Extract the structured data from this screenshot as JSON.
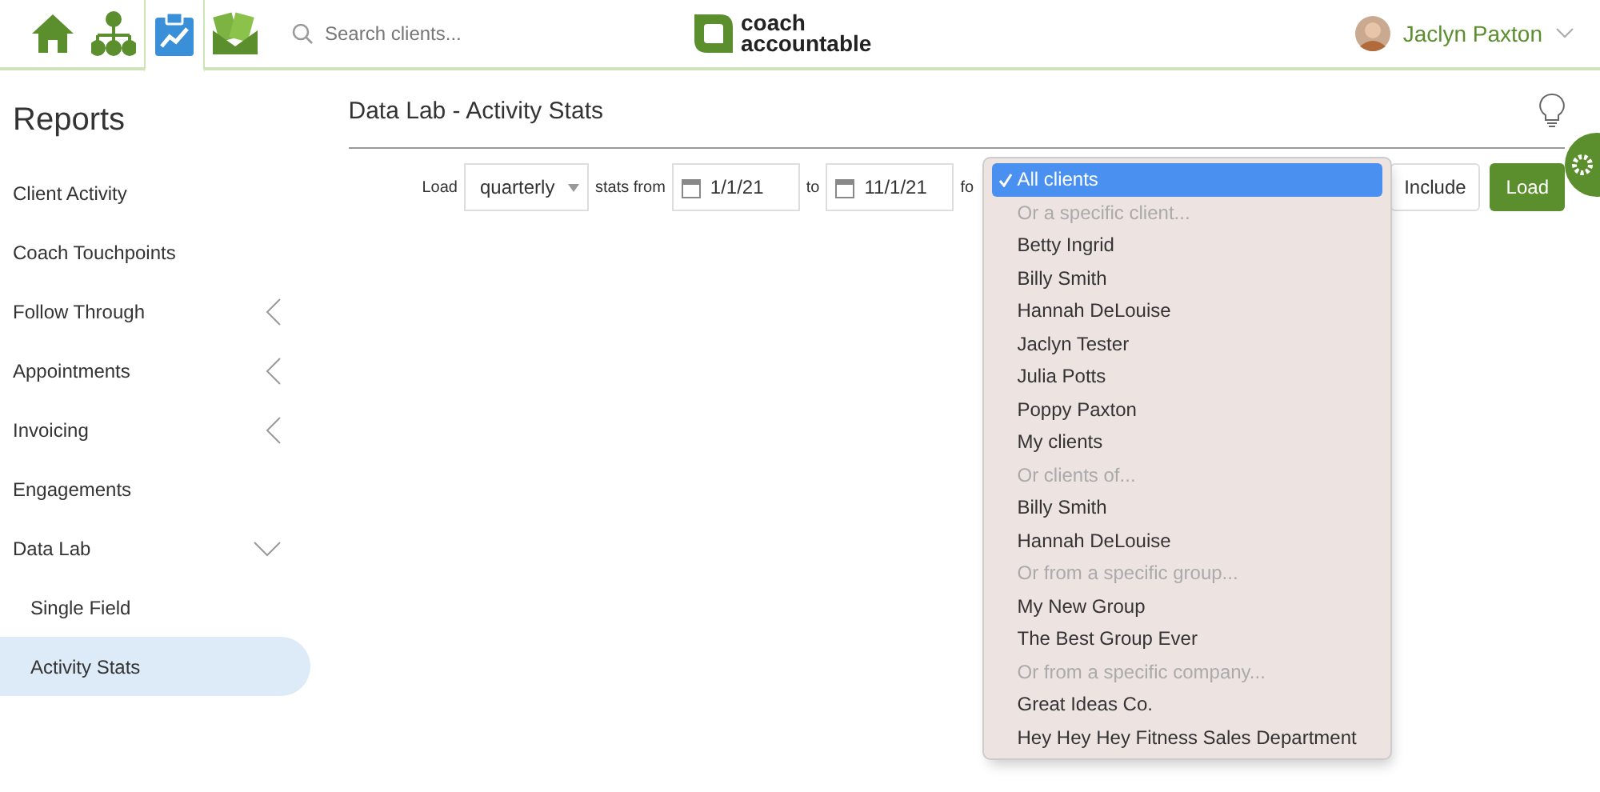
{
  "top_bar": {
    "nav": [
      {
        "selected": false
      },
      {
        "selected": false
      },
      {
        "selected": true
      },
      {
        "selected": false
      }
    ],
    "search": {
      "placeholder": "Search clients..."
    },
    "logo": {
      "line1": "coach",
      "line2": "accountable"
    },
    "user": {
      "name": "Jaclyn Paxton"
    }
  },
  "sidebar": {
    "title": "Reports",
    "items": [
      {
        "label": "Client Activity",
        "selected": false
      },
      {
        "label": "Coach Touchpoints",
        "selected": false
      },
      {
        "label": "Follow Through",
        "selected": false,
        "expanded": false
      },
      {
        "label": "Appointments",
        "selected": false,
        "expanded": false
      },
      {
        "label": "Invoicing",
        "selected": false,
        "expanded": false
      },
      {
        "label": "Engagements",
        "selected": false
      },
      {
        "label": "Data Lab",
        "selected": false,
        "expanded": true,
        "children": [
          {
            "label": "Single Field",
            "selected": false
          },
          {
            "label": "Activity Stats",
            "selected": true
          }
        ]
      }
    ]
  },
  "main": {
    "title": "Data Lab - Activity Stats",
    "controls": {
      "load_label": "Load",
      "period": "quarterly",
      "from_label": "stats from",
      "from": "1/1/21",
      "to_label": "to",
      "to": "11/1/21",
      "for_label": "fo",
      "include": "Include",
      "load_button": "Load"
    },
    "dropdown": [
      {
        "kind": "option",
        "label": "All clients",
        "selected": true
      },
      {
        "kind": "header",
        "label": "Or a specific client..."
      },
      {
        "kind": "option",
        "label": "Betty Ingrid",
        "selected": false
      },
      {
        "kind": "option",
        "label": "Billy Smith",
        "selected": false
      },
      {
        "kind": "option",
        "label": "Hannah DeLouise",
        "selected": false
      },
      {
        "kind": "option",
        "label": "Jaclyn Tester",
        "selected": false
      },
      {
        "kind": "option",
        "label": "Julia Potts",
        "selected": false
      },
      {
        "kind": "option",
        "label": "Poppy Paxton",
        "selected": false
      },
      {
        "kind": "option",
        "label": "My clients",
        "selected": false
      },
      {
        "kind": "header",
        "label": "Or clients of..."
      },
      {
        "kind": "option",
        "label": "Billy Smith",
        "selected": false
      },
      {
        "kind": "option",
        "label": "Hannah DeLouise",
        "selected": false
      },
      {
        "kind": "header",
        "label": "Or from a specific group..."
      },
      {
        "kind": "option",
        "label": "My New Group",
        "selected": false
      },
      {
        "kind": "option",
        "label": "The Best Group Ever",
        "selected": false
      },
      {
        "kind": "header",
        "label": "Or from a specific company..."
      },
      {
        "kind": "option",
        "label": "Great Ideas Co.",
        "selected": false
      },
      {
        "kind": "option",
        "label": "Hey Hey Hey Fitness Sales Department",
        "selected": false
      }
    ]
  }
}
